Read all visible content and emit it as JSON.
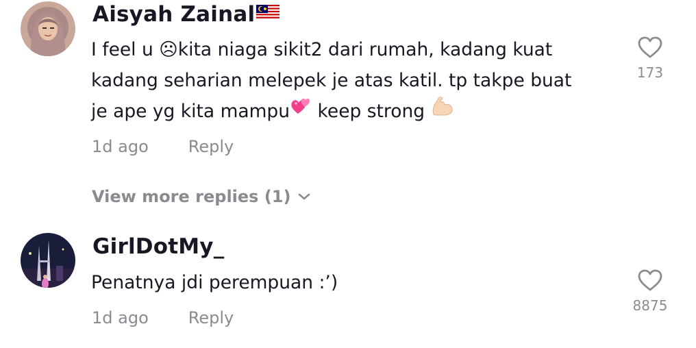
{
  "comments": [
    {
      "username": "Aisyah Zainal",
      "username_flag": "malaysia-flag-icon",
      "text_lines": [
        "I feel u ☹kita niaga sikit2 dari rumah, kadang kuat",
        "kadang seharian melepek je atas katil. tp takpe buat",
        "je ape yg kita mampu",
        " keep strong "
      ],
      "text_icons": [
        "two-hearts-emoji-icon",
        "flexed-biceps-emoji-icon"
      ],
      "time": "1d ago",
      "reply_label": "Reply",
      "like_count": "173",
      "view_more": "View more replies (1)"
    },
    {
      "username": "GirlDotMy_",
      "text": "Penatnya jdi perempuan :’)",
      "time": "1d ago",
      "reply_label": "Reply",
      "like_count": "8875"
    }
  ],
  "colors": {
    "text": "#161823",
    "muted": "#8a8b91",
    "background": "#ffffff"
  }
}
